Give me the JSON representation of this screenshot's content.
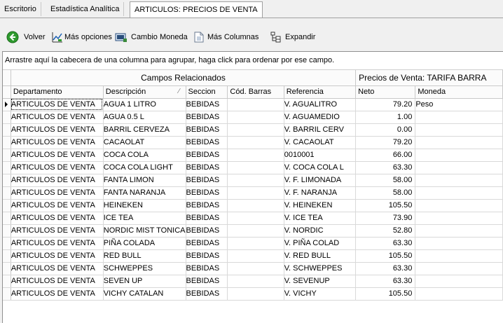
{
  "tabs": [
    {
      "label": "Escritorio",
      "active": false
    },
    {
      "label": "Estadística Analítica",
      "active": false
    },
    {
      "label": "ARTICULOS: PRECIOS DE VENTA",
      "active": true
    }
  ],
  "toolbar": {
    "volver": "Volver",
    "mas_opciones": "Más opciones",
    "cambio_moneda": "Cambio Moneda",
    "mas_columnas": "Más Columnas",
    "expandir": "Expandir"
  },
  "group_prompt": "Arrastre aquí la cabecera de una columna para agrupar, haga click para ordenar por ese campo.",
  "bands": {
    "related": "Campos Relacionados",
    "prices": "Precios de Venta: TARIFA BARRA"
  },
  "columns": {
    "departamento": "Departamento",
    "descripcion": "Descripción",
    "seccion": "Seccion",
    "cod_barras": "Cód. Barras",
    "referencia": "Referencia",
    "neto": "Neto",
    "moneda": "Moneda"
  },
  "rows": [
    {
      "departamento": "ARTICULOS DE VENTA",
      "descripcion": "AGUA  1 LITRO",
      "seccion": "BEBIDAS",
      "cod_barras": "",
      "referencia": "V. AGUALITRO",
      "neto": "79.20",
      "moneda": "Peso"
    },
    {
      "departamento": "ARTICULOS DE VENTA",
      "descripcion": "AGUA 0.5 L",
      "seccion": "BEBIDAS",
      "cod_barras": "",
      "referencia": "V. AGUAMEDIO",
      "neto": "1.00",
      "moneda": ""
    },
    {
      "departamento": "ARTICULOS DE VENTA",
      "descripcion": "BARRIL CERVEZA",
      "seccion": "BEBIDAS",
      "cod_barras": "",
      "referencia": "V. BARRIL CERV",
      "neto": "0.00",
      "moneda": ""
    },
    {
      "departamento": "ARTICULOS DE VENTA",
      "descripcion": "CACAOLAT",
      "seccion": "BEBIDAS",
      "cod_barras": "",
      "referencia": "V. CACAOLAT",
      "neto": "79.20",
      "moneda": ""
    },
    {
      "departamento": "ARTICULOS DE VENTA",
      "descripcion": "COCA COLA",
      "seccion": "BEBIDAS",
      "cod_barras": "",
      "referencia": "0010001",
      "neto": "66.00",
      "moneda": ""
    },
    {
      "departamento": "ARTICULOS DE VENTA",
      "descripcion": "COCA COLA  LIGHT",
      "seccion": "BEBIDAS",
      "cod_barras": "",
      "referencia": "V. COCA COLA L",
      "neto": "63.30",
      "moneda": ""
    },
    {
      "departamento": "ARTICULOS DE VENTA",
      "descripcion": "FANTA LIMON",
      "seccion": "BEBIDAS",
      "cod_barras": "",
      "referencia": "V. F. LIMONADA",
      "neto": "58.00",
      "moneda": ""
    },
    {
      "departamento": "ARTICULOS DE VENTA",
      "descripcion": "FANTA NARANJA",
      "seccion": "BEBIDAS",
      "cod_barras": "",
      "referencia": "V. F. NARANJA",
      "neto": "58.00",
      "moneda": ""
    },
    {
      "departamento": "ARTICULOS DE VENTA",
      "descripcion": "HEINEKEN",
      "seccion": "BEBIDAS",
      "cod_barras": "",
      "referencia": "V. HEINEKEN",
      "neto": "105.50",
      "moneda": ""
    },
    {
      "departamento": "ARTICULOS DE VENTA",
      "descripcion": "ICE TEA",
      "seccion": "BEBIDAS",
      "cod_barras": "",
      "referencia": "V. ICE TEA",
      "neto": "73.90",
      "moneda": ""
    },
    {
      "departamento": "ARTICULOS DE VENTA",
      "descripcion": "NORDIC MIST TONICA",
      "seccion": "BEBIDAS",
      "cod_barras": "",
      "referencia": "V. NORDIC",
      "neto": "52.80",
      "moneda": ""
    },
    {
      "departamento": "ARTICULOS DE VENTA",
      "descripcion": "PIÑA COLADA",
      "seccion": "BEBIDAS",
      "cod_barras": "",
      "referencia": "V. PIÑA COLAD",
      "neto": "63.30",
      "moneda": ""
    },
    {
      "departamento": "ARTICULOS DE VENTA",
      "descripcion": "RED BULL",
      "seccion": "BEBIDAS",
      "cod_barras": "",
      "referencia": "V. RED BULL",
      "neto": "105.50",
      "moneda": ""
    },
    {
      "departamento": "ARTICULOS DE VENTA",
      "descripcion": "SCHWEPPES",
      "seccion": "BEBIDAS",
      "cod_barras": "",
      "referencia": "V. SCHWEPPES",
      "neto": "63.30",
      "moneda": ""
    },
    {
      "departamento": "ARTICULOS DE VENTA",
      "descripcion": "SEVEN UP",
      "seccion": "BEBIDAS",
      "cod_barras": "",
      "referencia": "V. SEVENUP",
      "neto": "63.30",
      "moneda": ""
    },
    {
      "departamento": "ARTICULOS DE VENTA",
      "descripcion": "VICHY CATALAN",
      "seccion": "BEBIDAS",
      "cod_barras": "",
      "referencia": "V. VICHY",
      "neto": "105.50",
      "moneda": ""
    }
  ],
  "icons": {
    "volver": "back-arrow-icon",
    "mas_opciones": "chart-options-icon",
    "cambio_moneda": "currency-change-icon",
    "mas_columnas": "columns-document-icon",
    "expandir": "expand-tree-icon"
  },
  "colors": {
    "accent_green": "#2e9a2e",
    "grid_line": "#d9d9d9"
  }
}
